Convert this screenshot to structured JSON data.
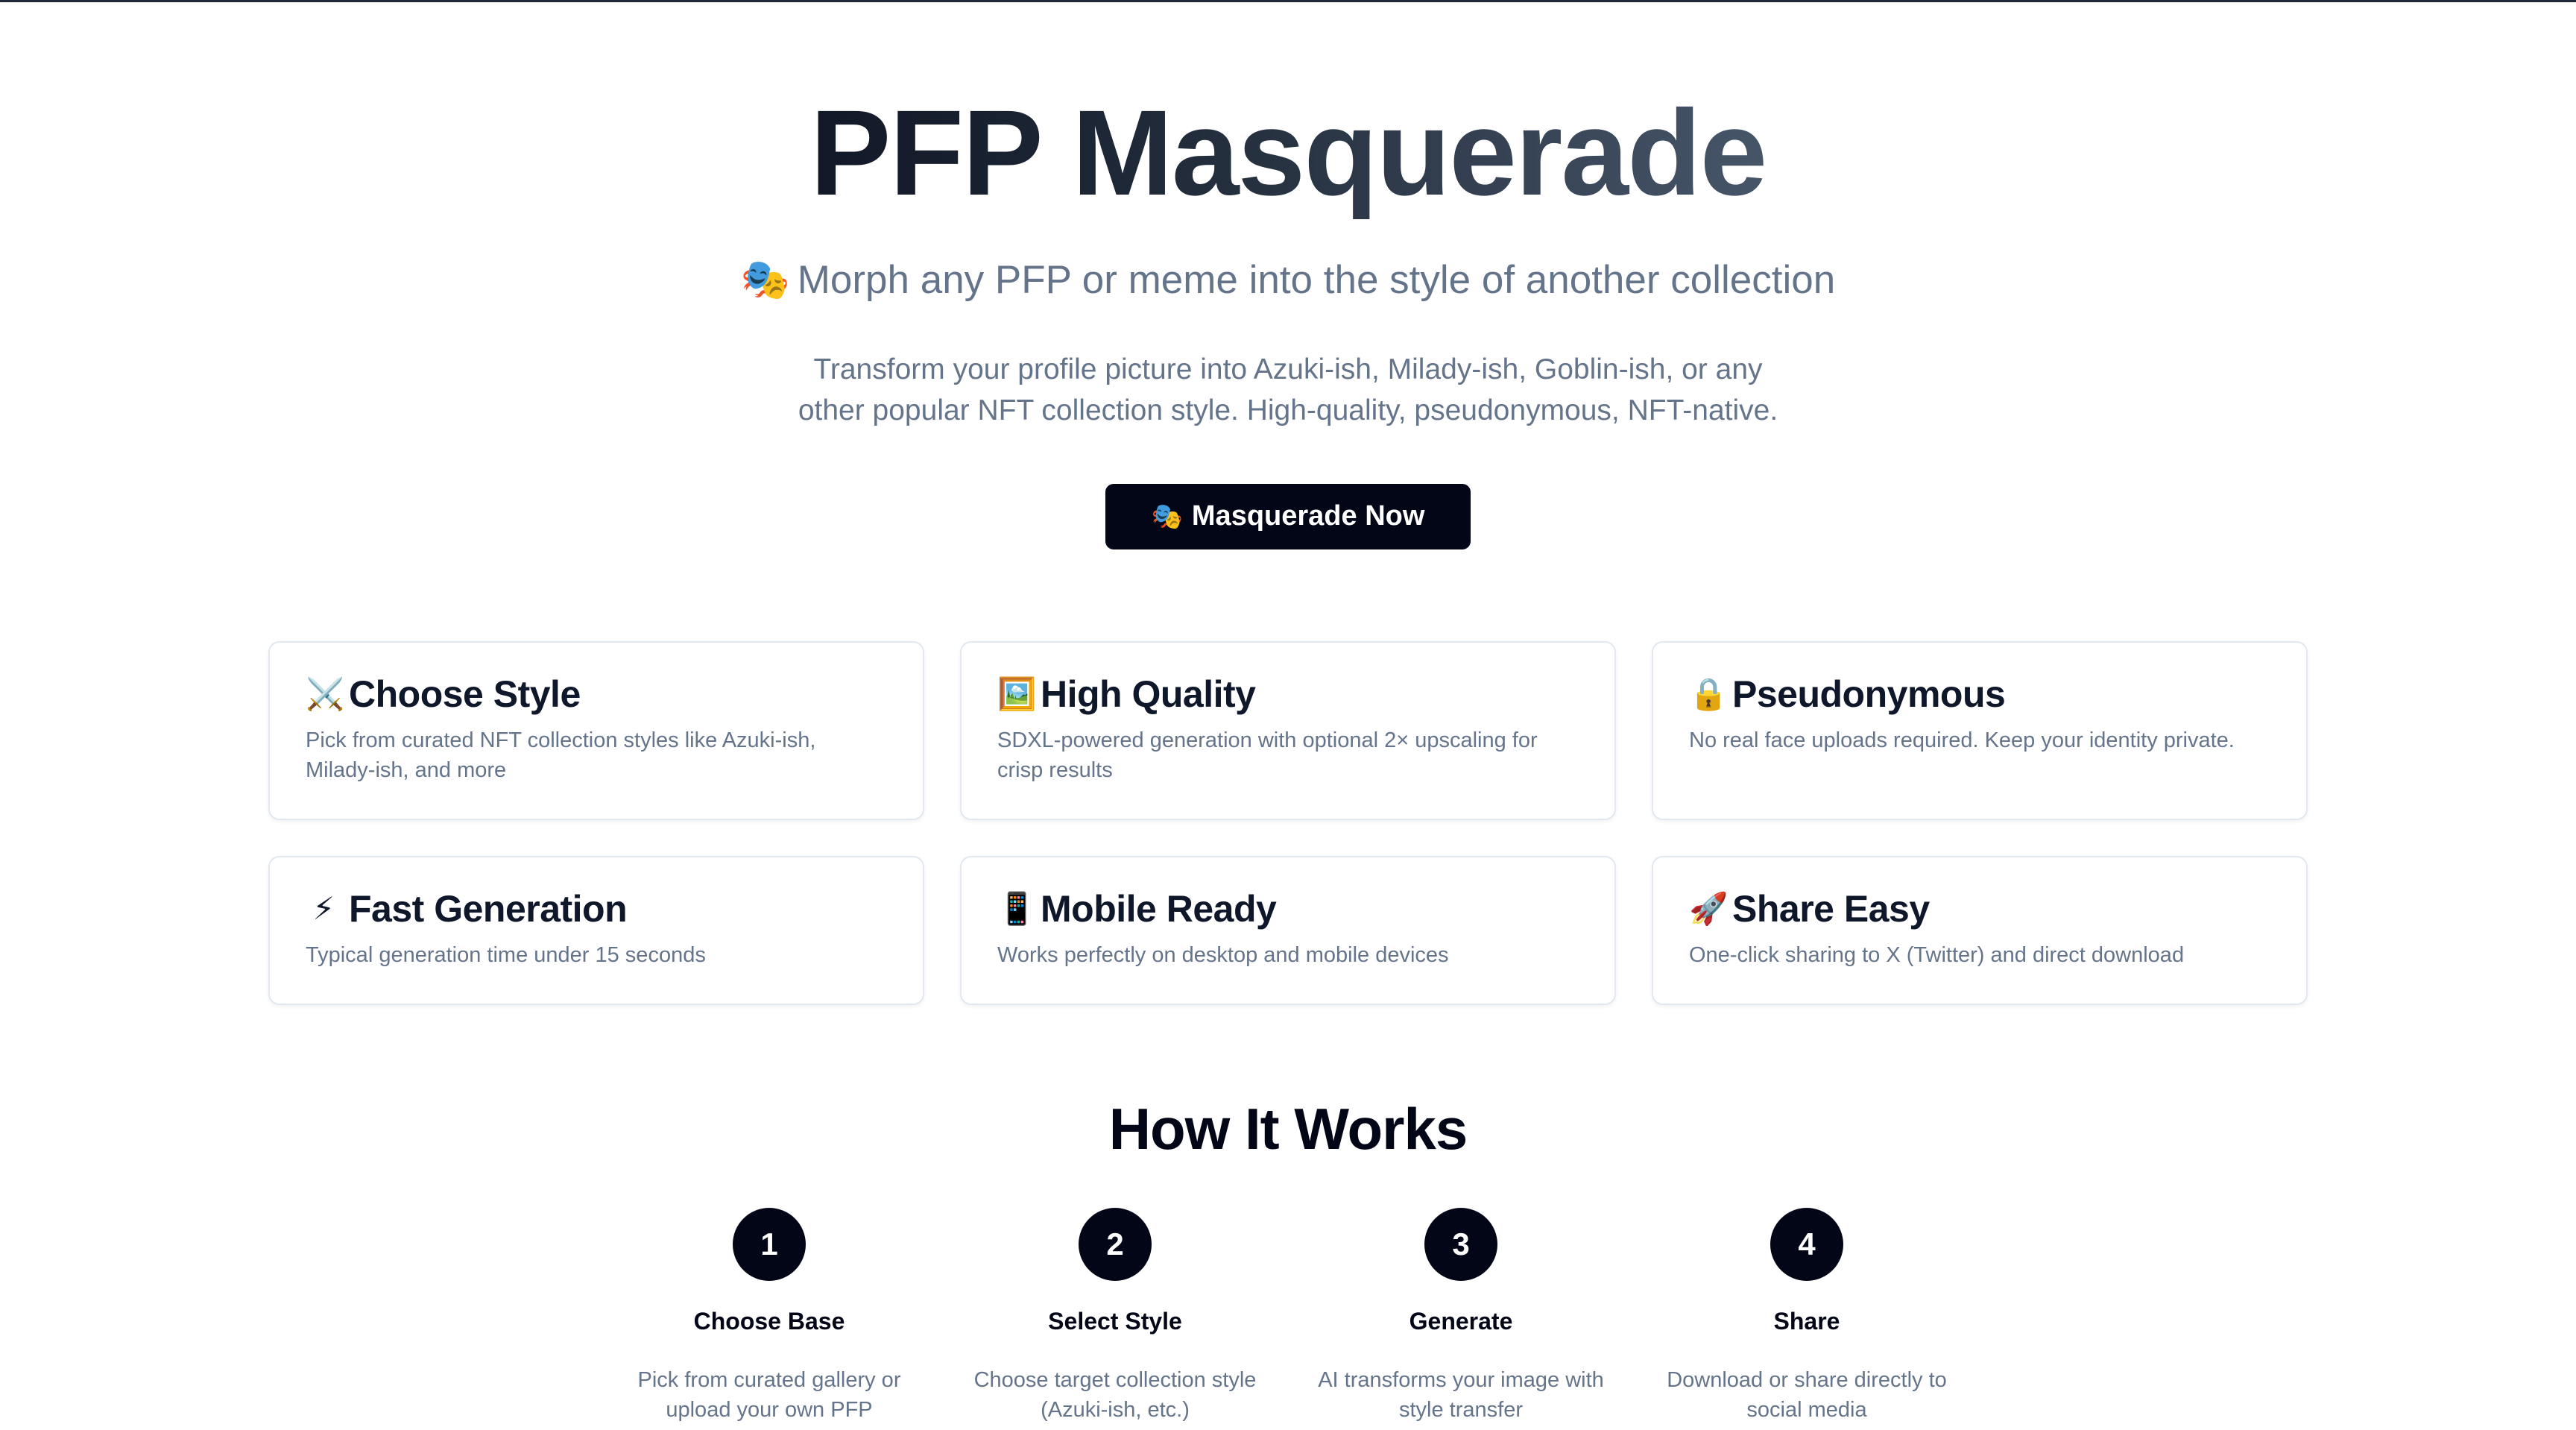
{
  "hero": {
    "title": "PFP Masquerade",
    "subtitle_icon": "🎭",
    "subtitle": "Morph any PFP or meme into the style of another collection",
    "description": "Transform your profile picture into Azuki-ish, Milady-ish, Goblin-ish, or any other popular NFT collection style. High-quality, pseudonymous, NFT-native.",
    "cta_icon": "🎭",
    "cta_label": "Masquerade Now"
  },
  "features": [
    {
      "icon": "⚔️",
      "title": "Choose Style",
      "description": "Pick from curated NFT collection styles like Azuki-ish, Milady-ish, and more"
    },
    {
      "icon": "🖼️",
      "title": "High Quality",
      "description": "SDXL-powered generation with optional 2× upscaling for crisp results"
    },
    {
      "icon": "🔒",
      "title": "Pseudonymous",
      "description": "No real face uploads required. Keep your identity private."
    },
    {
      "icon": "⚡",
      "title": "Fast Generation",
      "description": "Typical generation time under 15 seconds"
    },
    {
      "icon": "📱",
      "title": "Mobile Ready",
      "description": "Works perfectly on desktop and mobile devices"
    },
    {
      "icon": "🚀",
      "title": "Share Easy",
      "description": "One-click sharing to X (Twitter) and direct download"
    }
  ],
  "how_it_works": {
    "title": "How It Works",
    "steps": [
      {
        "number": "1",
        "title": "Choose Base",
        "description": "Pick from curated gallery or upload your own PFP"
      },
      {
        "number": "2",
        "title": "Select Style",
        "description": "Choose target collection style (Azuki-ish, etc.)"
      },
      {
        "number": "3",
        "title": "Generate",
        "description": "AI transforms your image with style transfer"
      },
      {
        "number": "4",
        "title": "Share",
        "description": "Download or share directly to social media"
      }
    ]
  }
}
